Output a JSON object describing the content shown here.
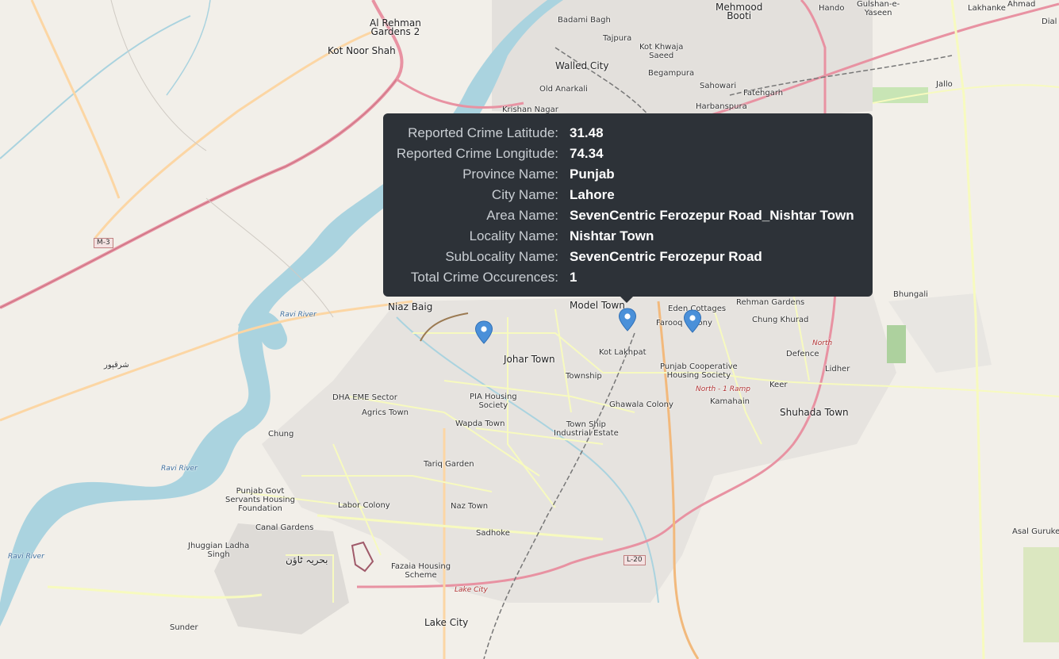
{
  "tooltip": {
    "rows": [
      {
        "key": "Reported Crime Latitude:",
        "value": "31.48"
      },
      {
        "key": "Reported Crime Longitude:",
        "value": "74.34"
      },
      {
        "key": "Province Name:",
        "value": "Punjab"
      },
      {
        "key": "City Name:",
        "value": "Lahore"
      },
      {
        "key": "Area Name:",
        "value": "SevenCentric Ferozepur Road_Nishtar Town"
      },
      {
        "key": "Locality Name:",
        "value": "Nishtar Town"
      },
      {
        "key": "SubLocality Name:",
        "value": "SevenCentric Ferozepur Road"
      },
      {
        "key": "Total Crime Occurences:",
        "value": "1"
      }
    ]
  },
  "map": {
    "colors": {
      "land": "#f2efe9",
      "water": "#aad3df",
      "motorway": "#e892a2",
      "primary": "#fcd6a4",
      "secondary": "#f7fabf",
      "marker": "#4a90d9",
      "tooltip_bg": "#2d3238"
    },
    "labels": {
      "al_rehman": "Al Rehman\nGardens 2",
      "kot_noor_shah": "Kot Noor Shah",
      "badami_bagh": "Badami Bagh",
      "mehmood_booti": "Mehmood\nBooti",
      "hando": "Hando",
      "gulshan_yaseen": "Gulshan-e-\nYaseen",
      "lakhanke": "Lakhanke",
      "ahmad": "Ahmad",
      "dial": "Dial",
      "tajpura": "Tajpura",
      "kot_khwaja_saeed": "Kot Khwaja\nSaeed",
      "walled_city": "Walled City",
      "begampura": "Begampura",
      "old_anarkali": "Old Anarkali",
      "sahowari": "Sahowari",
      "jallo": "Jallo",
      "fatehgarh": "Fatehgarh",
      "krishan_nagar": "Krishan Nagar",
      "harbanspura": "Harbanspura",
      "m3": "M-3",
      "ravi_river_1": "Ravi River",
      "ravi_river_2": "Ravi River",
      "ravi_river_3": "Ravi River",
      "sharaqpur": "شرقپور",
      "niaz_baig": "Niaz Baig",
      "model_town": "Model Town",
      "eden_cottages": "Eden Cottages",
      "rehman_gardens": "Rehman Gardens",
      "bhungali": "Bhungali",
      "farooq_colony": "Farooq Colony",
      "chung_khurad": "Chung Khurad",
      "johar_town": "Johar Town",
      "kot_lakhpat": "Kot Lakhpat",
      "north": "North",
      "defence": "Defence",
      "township": "Township",
      "punjab_coop": "Punjab Cooperative\nHousing Society",
      "lidher": "Lidher",
      "north_ramp": "North - 1 Ramp",
      "keer": "Keer",
      "kamahain": "Kamahain",
      "dha_eme": "DHA EME Sector",
      "pia_housing": "PIA Housing\nSociety",
      "agrics_town": "Agrics Town",
      "ghawala_colony": "Ghawala Colony",
      "shuhada_town": "Shuhada Town",
      "wapda_town": "Wapda Town",
      "town_ship_ie": "Town Ship\nIndustrial Estate",
      "chung": "Chung",
      "tariq_garden": "Tariq Garden",
      "punjab_govt": "Punjab Govt\nServants Housing\nFoundation",
      "labor_colony": "Labor Colony",
      "naz_town": "Naz Town",
      "canal_gardens": "Canal Gardens",
      "sadhoke": "Sadhoke",
      "asal_guruke": "Asal Guruke",
      "jhuggian": "Jhuggian Ladha\nSingh",
      "bahria_town": "بحریہ ٹاؤن",
      "l20": "L-20",
      "fazaia": "Fazaia Housing\nScheme",
      "lake_city_road": "Lake City",
      "lake_city": "Lake City",
      "sunder": "Sunder"
    }
  }
}
